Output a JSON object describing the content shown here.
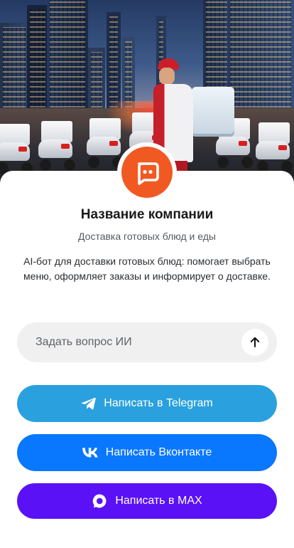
{
  "hero": {
    "image_alt": "Курьер доставки с термосумкой рядом со скутерами на фоне ночного города"
  },
  "company": {
    "name": "Название компании",
    "subtitle": "Доставка готовых блюд и еды",
    "description": "AI-бот для доставки готовых блюд: помогает выбрать меню, оформляет заказы и информирует о доставке.",
    "avatar_icon": "chat-bot-icon",
    "brand_color": "#f05a22"
  },
  "ask": {
    "placeholder": "Задать вопрос ИИ",
    "send_icon": "arrow-up-icon"
  },
  "buttons": {
    "telegram": {
      "label": "Написать в Telegram",
      "icon": "telegram-icon",
      "color": "#2aa1de"
    },
    "vk": {
      "label": "Написать Вконтакте",
      "icon": "vk-icon",
      "color": "#0a77ff"
    },
    "max": {
      "label": "Написать в MAX",
      "icon": "max-icon",
      "color": "#5b11f5"
    }
  }
}
